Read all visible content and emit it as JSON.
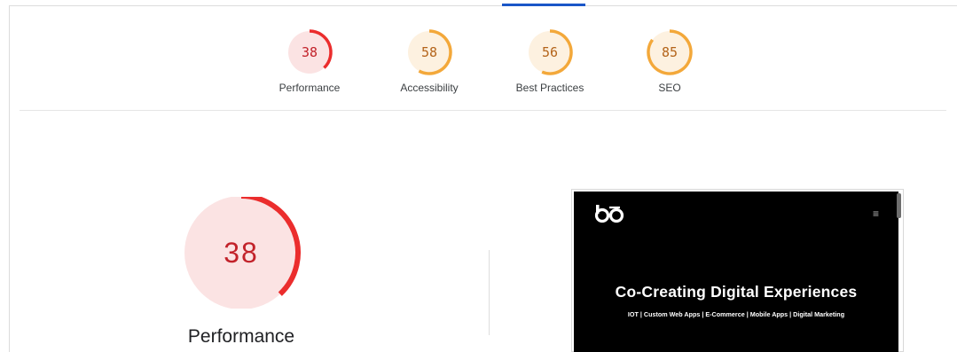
{
  "scores": [
    {
      "name": "Performance",
      "value": 38,
      "status": "fail"
    },
    {
      "name": "Accessibility",
      "value": 58,
      "status": "average"
    },
    {
      "name": "Best Practices",
      "value": 56,
      "status": "average"
    },
    {
      "name": "SEO",
      "value": 85,
      "status": "average"
    }
  ],
  "colors": {
    "fail_stroke": "#eb2d2d",
    "fail_fill": "#fbe3e3",
    "fail_text": "#c2222a",
    "average_stroke": "#f3a83a",
    "average_fill": "#fdf1e0",
    "average_text": "#b4641a",
    "accent_tab": "#1a56c8"
  },
  "focus": {
    "value": 38,
    "label": "Performance"
  },
  "preview": {
    "menu_icon": "≡",
    "title": "Co-Creating Digital Experiences",
    "subtitle": "IOT | Custom Web Apps | E-Commerce | Mobile Apps | Digital Marketing"
  }
}
